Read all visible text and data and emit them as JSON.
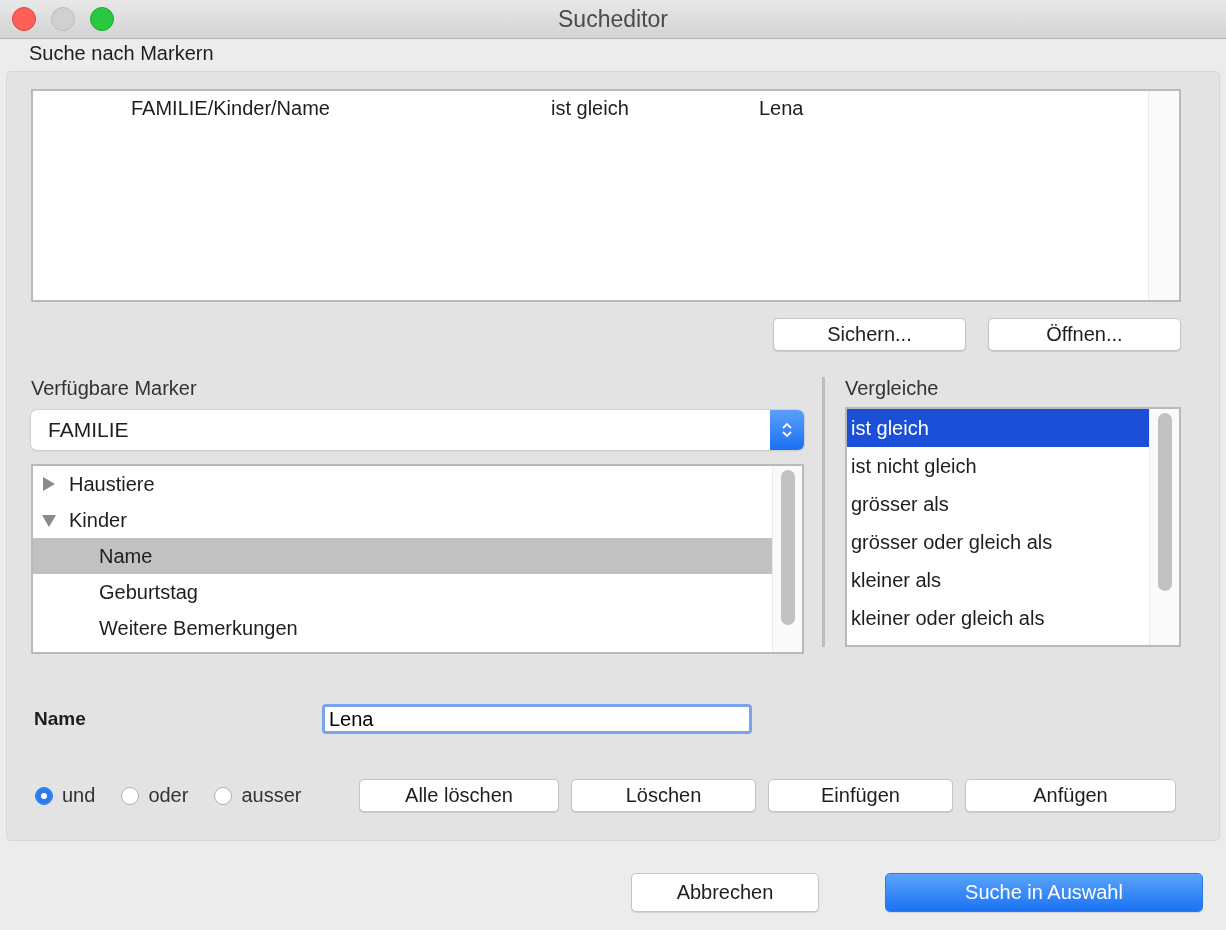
{
  "window": {
    "title": "Sucheditor"
  },
  "criteria_section": {
    "label": "Suche nach Markern",
    "rows": [
      {
        "marker": "FAMILIE/Kinder/Name",
        "comparison": "ist gleich",
        "value": "Lena"
      }
    ],
    "buttons": [
      "Sichern...",
      "Öffnen..."
    ]
  },
  "markers": {
    "label": "Verfügbare Marker",
    "category": "FAMILIE",
    "tree": [
      {
        "label": "Haustiere",
        "expanded": false,
        "selected": false
      },
      {
        "label": "Kinder",
        "expanded": true,
        "selected": false,
        "children": [
          {
            "label": "Name",
            "selected": true
          },
          {
            "label": "Geburtstag",
            "selected": false
          },
          {
            "label": "Weitere Bemerkungen",
            "selected": false
          }
        ]
      }
    ]
  },
  "comparisons": {
    "label": "Vergleiche",
    "items": [
      {
        "label": "ist gleich",
        "selected": true
      },
      {
        "label": "ist nicht gleich",
        "selected": false
      },
      {
        "label": "grösser als",
        "selected": false
      },
      {
        "label": "grösser oder gleich als",
        "selected": false
      },
      {
        "label": "kleiner als",
        "selected": false
      },
      {
        "label": "kleiner oder gleich als",
        "selected": false
      }
    ]
  },
  "value_field": {
    "label": "Name",
    "value": "Lena"
  },
  "logic": [
    {
      "label": "und",
      "selected": true
    },
    {
      "label": "oder",
      "selected": false
    },
    {
      "label": "ausser",
      "selected": false
    }
  ],
  "edit_buttons": [
    "Alle löschen",
    "Löschen",
    "Einfügen",
    "Anfügen"
  ],
  "footer": {
    "cancel": "Abbrechen",
    "confirm": "Suche in Auswahl"
  }
}
